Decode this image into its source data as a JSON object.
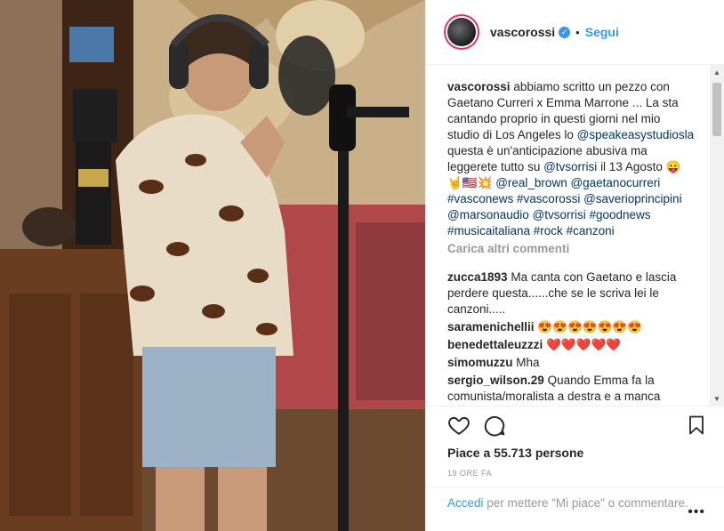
{
  "post": {
    "username": "vascorossi",
    "follow_label": "Segui",
    "separator": "•",
    "caption": {
      "username": "vascorossi",
      "text1": "abbiamo scritto un pezzo con Gaetano Curreri x Emma Marrone ... La sta cantando proprio in questi giorni nel mio studio di Los Angeles lo",
      "mention1": "@speakeasystudiosla",
      "text2": "questa è un'anticipazione abusiva ma leggerete tutto su",
      "mention2": "@tvsorrisi",
      "text3": "il 13 Agosto 😛🤘🇺🇸💥",
      "tags": "@real_brown @gaetanocurreri #vasconews #vascorossi @saverioprincipini @marsonaudio @tvsorrisi #goodnews #musicaitaliana #rock #canzoni"
    },
    "load_more": "Carica altri commenti",
    "comments": [
      {
        "user": "zucca1893",
        "text": "Ma canta con Gaetano e lascia perdere questa......che se le scriva lei le canzoni....."
      },
      {
        "user": "saramenichellii",
        "text": "😍😍😍😍😍😍😍"
      },
      {
        "user": "benedettaleuzzzi",
        "text": "❤️❤️❤️❤️❤️"
      },
      {
        "user": "simomuzzu",
        "text": "Mha"
      },
      {
        "user": "sergio_wilson.29",
        "text": "Quando Emma fa la comunista/moralista a destra e a manca"
      }
    ],
    "likes": "Piace a 55.713 persone",
    "time": "19 ORE FA",
    "login_prompt": {
      "link": "Accedi",
      "text": "per mettere \"Mi piace\" o commentare."
    },
    "more_options": "•••"
  },
  "icons": {
    "like": "heart-outline-icon",
    "comment": "speech-bubble-icon",
    "save": "bookmark-icon",
    "verified": "verified-badge-icon"
  },
  "colors": {
    "link": "#003569",
    "accent": "#3897f0",
    "muted": "#999999",
    "heart": "#ed4956"
  }
}
